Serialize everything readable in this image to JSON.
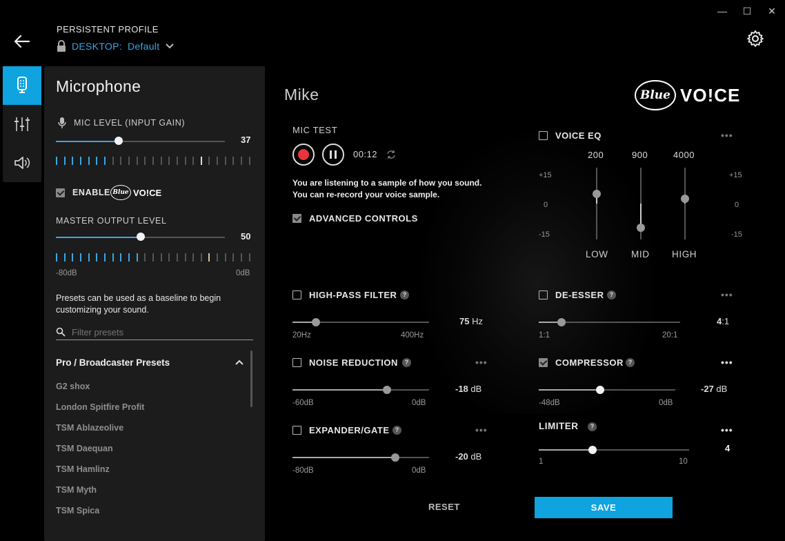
{
  "window": {
    "minimize": "—",
    "maximize": "☐",
    "close": "✕"
  },
  "header": {
    "profile_label": "PERSISTENT PROFILE",
    "profile_prefix": "DESKTOP:",
    "profile_value": "Default"
  },
  "panel": {
    "title": "Microphone",
    "mic_level_label": "MIC LEVEL (INPUT GAIN)",
    "mic_level_value": "37",
    "mic_level_fraction": 0.37,
    "enable_label": "ENABLE",
    "enable_checked": true,
    "logo_blue": "Blue",
    "logo_voice": "VO!CE",
    "master_label": "MASTER OUTPUT LEVEL",
    "master_value": "50",
    "master_fraction": 0.5,
    "master_min": "-80dB",
    "master_max": "0dB",
    "presets_desc_1": "Presets can be used as a baseline to begin",
    "presets_desc_2": "customizing your sound.",
    "filter_placeholder": "Filter presets",
    "preset_group": "Pro / Broadcaster Presets",
    "presets": [
      "G2 shox",
      "London Spitfire Profit",
      "TSM Ablazeolive",
      "TSM Daequan",
      "TSM Hamlinz",
      "TSM Myth",
      "TSM Spica"
    ]
  },
  "main": {
    "profile_name": "Mike",
    "logo_blue": "Blue",
    "logo_voice": "VO!CE",
    "mic_test_label": "MIC TEST",
    "timer": "00:12",
    "listen_1": "You are listening to a sample of how you sound.",
    "listen_2": "You can re-record your voice sample.",
    "advanced_label": "ADVANCED CONTROLS",
    "voice_eq": {
      "label": "VOICE EQ",
      "freqs": [
        "200",
        "900",
        "4000"
      ],
      "bands": [
        "LOW",
        "MID",
        "HIGH"
      ],
      "scale_top": "+15",
      "scale_mid": "0",
      "scale_bot": "-15",
      "levels": [
        4,
        -10,
        2
      ]
    },
    "hpf": {
      "label": "HIGH-PASS FILTER",
      "value": "75",
      "unit": "Hz",
      "min": "20Hz",
      "max": "400Hz",
      "fraction": 0.17
    },
    "noise": {
      "label": "NOISE REDUCTION",
      "value": "-18",
      "unit": "dB",
      "min": "-60dB",
      "max": "0dB",
      "fraction": 0.69
    },
    "gate": {
      "label": "EXPANDER/GATE",
      "value": "-20",
      "unit": "dB",
      "min": "-80dB",
      "max": "0dB",
      "fraction": 0.75
    },
    "deesser": {
      "label": "DE-ESSER",
      "value": "4",
      "unit": ":1",
      "min": "1:1",
      "max": "20:1",
      "fraction": 0.16
    },
    "compressor": {
      "label": "COMPRESSOR",
      "value": "-27",
      "unit": "dB",
      "min": "-48dB",
      "max": "0dB",
      "fraction": 0.45,
      "checked": true
    },
    "limiter": {
      "label": "LIMITER",
      "value": "4",
      "min": "1",
      "max": "10",
      "fraction": 0.36
    },
    "reset_label": "RESET",
    "save_label": "SAVE",
    "help_glyph": "?",
    "more_glyph": "•••"
  }
}
